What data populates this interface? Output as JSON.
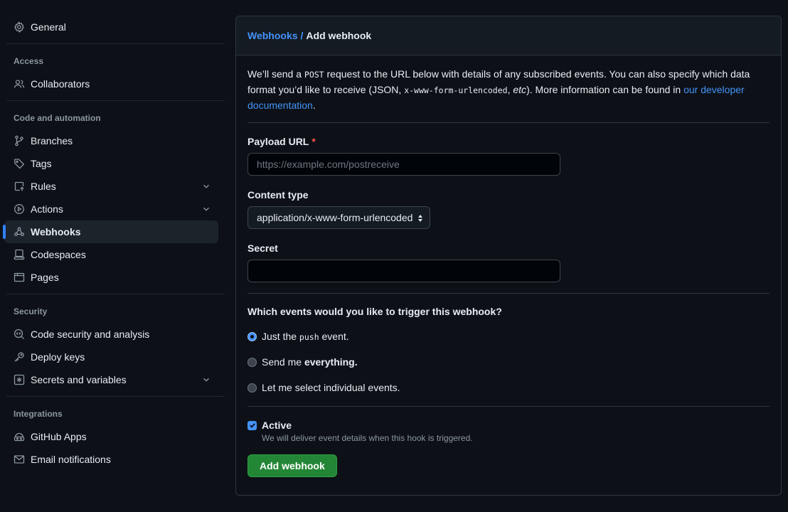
{
  "sidebar": {
    "general": {
      "label": "General",
      "icon": "gear-icon"
    },
    "sections": {
      "access": "Access",
      "code_automation": "Code and automation",
      "security": "Security",
      "integrations": "Integrations"
    },
    "items": {
      "collaborators": {
        "label": "Collaborators",
        "icon": "people-icon"
      },
      "branches": {
        "label": "Branches",
        "icon": "branch-icon"
      },
      "tags": {
        "label": "Tags",
        "icon": "tag-icon"
      },
      "rules": {
        "label": "Rules",
        "icon": "rules-icon"
      },
      "actions": {
        "label": "Actions",
        "icon": "play-icon"
      },
      "webhooks": {
        "label": "Webhooks",
        "icon": "webhook-icon"
      },
      "codespaces": {
        "label": "Codespaces",
        "icon": "codespaces-icon"
      },
      "pages": {
        "label": "Pages",
        "icon": "browser-icon"
      },
      "code_security": {
        "label": "Code security and analysis",
        "icon": "codescan-icon"
      },
      "deploy_keys": {
        "label": "Deploy keys",
        "icon": "key-icon"
      },
      "secrets": {
        "label": "Secrets and variables",
        "icon": "asterisk-icon"
      },
      "github_apps": {
        "label": "GitHub Apps",
        "icon": "apps-icon"
      },
      "email_notifications": {
        "label": "Email notifications",
        "icon": "mail-icon"
      }
    }
  },
  "header": {
    "crumb_link": "Webhooks",
    "separator": "/",
    "title": "Add webhook"
  },
  "intro": {
    "p1": "We’ll send a ",
    "post": "POST",
    "p2": " request to the URL below with details of any subscribed events. You can also specify which data format you’d like to receive (JSON, ",
    "urlencoded": "x-www-form-urlencoded",
    "p3": ", ",
    "etc": "etc",
    "p4": "). More information can be found in ",
    "link": "our developer documentation",
    "p5": "."
  },
  "form": {
    "payload_label": "Payload URL",
    "required_mark": "*",
    "payload_placeholder": "https://example.com/postreceive",
    "content_type_label": "Content type",
    "content_type_value": "application/x-www-form-urlencoded",
    "secret_label": "Secret",
    "secret_value": ""
  },
  "events": {
    "question": "Which events would you like to trigger this webhook?",
    "opt1_a": "Just the ",
    "opt1_code": "push",
    "opt1_b": " event.",
    "opt2_a": "Send me ",
    "opt2_b": "everything.",
    "opt3": "Let me select individual events.",
    "selected": "push"
  },
  "active": {
    "label": "Active",
    "checked": true,
    "note": "We will deliver event details when this hook is triggered."
  },
  "submit_label": "Add webhook",
  "colors": {
    "accent": "#4493f8",
    "primary_button": "#238636",
    "background": "#0d1117"
  }
}
